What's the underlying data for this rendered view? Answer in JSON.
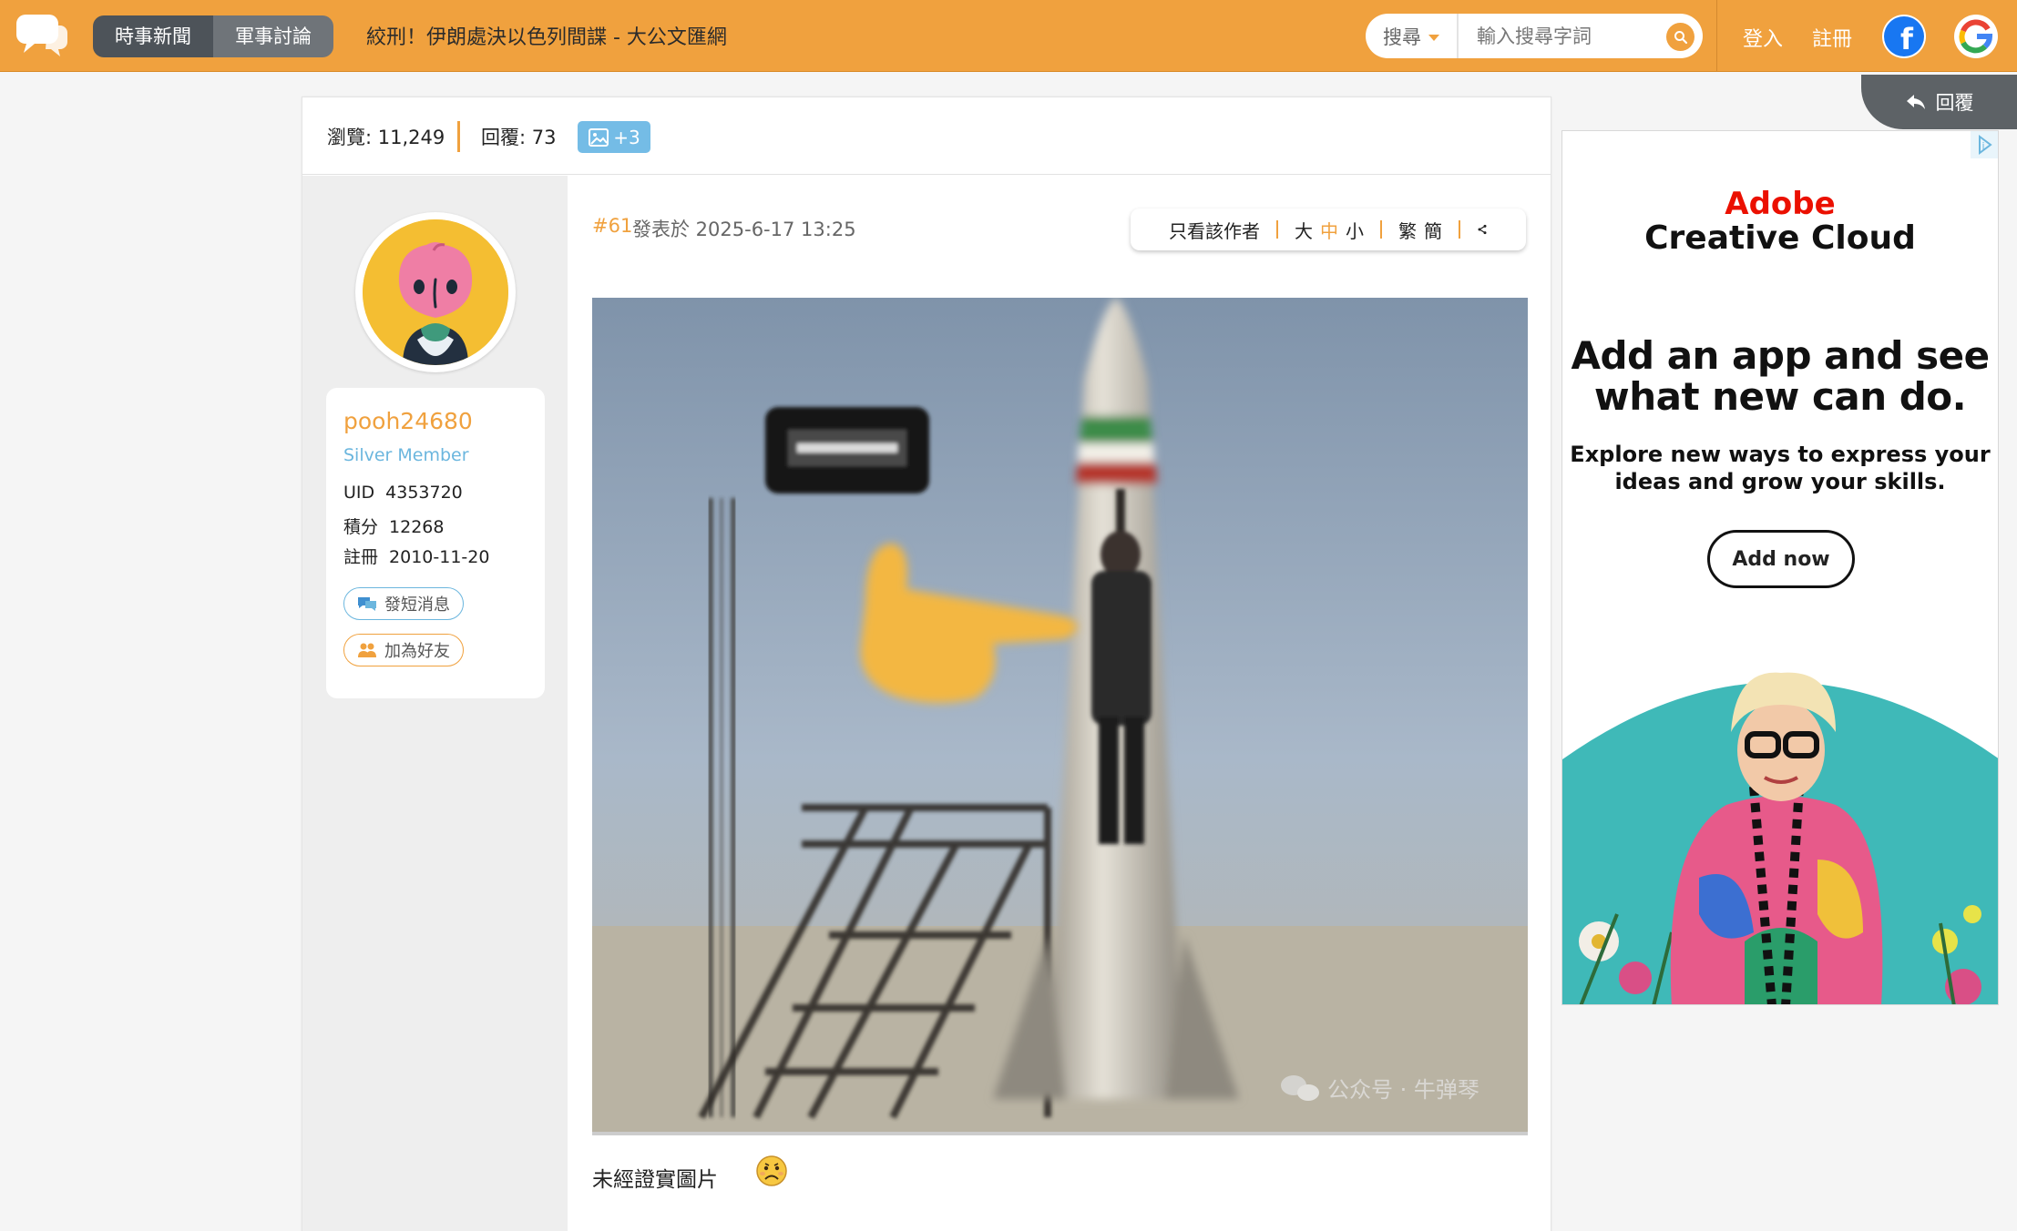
{
  "topbar": {
    "tabs": [
      {
        "label": "時事新聞",
        "active": true
      },
      {
        "label": "軍事討論",
        "active": false
      }
    ],
    "page_title": "絞刑！伊朗處決以色列間諜 - 大公文匯網",
    "search": {
      "scope": "搜尋",
      "placeholder": "輸入搜尋字詞"
    },
    "login": "登入",
    "register": "註冊",
    "facebook_letter": "f",
    "google_letter": "G",
    "accent_color": "#f0a13e"
  },
  "reply_tab": {
    "label": "回覆"
  },
  "stats": {
    "views_label": "瀏覽:",
    "views": "11,249",
    "replies_label": "回覆:",
    "replies": "73",
    "images_badge": "+3"
  },
  "author": {
    "name": "pooh24680",
    "rank": "Silver Member",
    "uid_label": "UID",
    "uid": "4353720",
    "points_label": "積分",
    "points": "12268",
    "registered_label": "註冊",
    "registered": "2010-11-20",
    "message_button": "發短消息",
    "friend_button": "加為好友"
  },
  "post": {
    "number": "#61",
    "posted_at": "發表於 2025-6-17 13:25",
    "tools": {
      "author_only": "只看該作者",
      "size_large": "大",
      "size_medium": "中",
      "size_small": "小",
      "traditional": "繁",
      "simplified": "簡"
    },
    "image_watermark": "公众号 · 牛弹琴",
    "caption": "未經證實圖片"
  },
  "ad": {
    "brand_line1": "Adobe",
    "brand_line2": "Creative Cloud",
    "headline_line1": "Add an app and see",
    "headline_line2": "what new can do.",
    "body_line1": "Explore new ways to express your",
    "body_line2": "ideas and grow your skills.",
    "cta": "Add now",
    "brand_color": "#eb1000"
  }
}
